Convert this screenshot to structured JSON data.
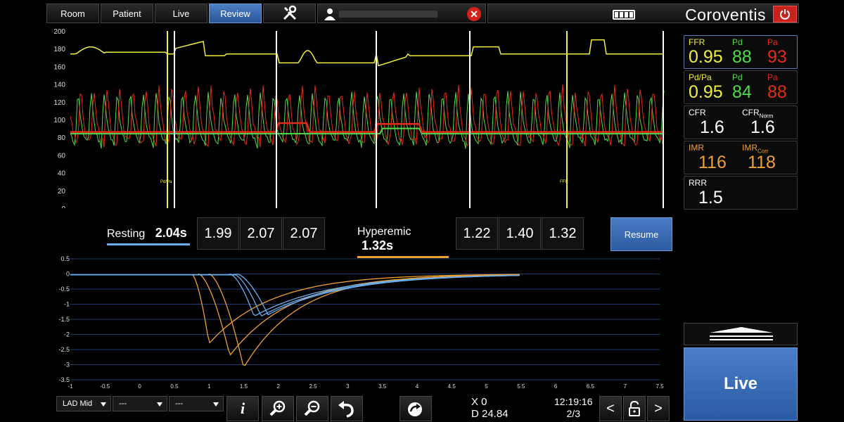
{
  "nav": {
    "tabs": [
      "Room",
      "Patient",
      "Live",
      "Review"
    ],
    "active_tab": "Review",
    "brand": "Coroventis"
  },
  "top_chart": {
    "y_ticks": [
      "200",
      "180",
      "160",
      "140",
      "120",
      "100",
      "80",
      "60",
      "40",
      "20",
      "0"
    ],
    "markers": [
      "Pd/Pa",
      "FFR"
    ]
  },
  "values": {
    "ffr": {
      "label": "FFR",
      "value": "0.95",
      "pd_label": "Pd",
      "pd": "88",
      "pa_label": "Pa",
      "pa": "93"
    },
    "pdpa": {
      "label": "Pd/Pa",
      "value": "0.95",
      "pd_label": "Pd",
      "pd": "84",
      "pa_label": "Pa",
      "pa": "88"
    },
    "cfr": {
      "label": "CFR",
      "value": "1.6",
      "norm_label": "CFR",
      "norm_sub": "Norm",
      "norm": "1.6"
    },
    "imr": {
      "label": "IMR",
      "value": "116",
      "corr_label": "IMR",
      "corr_sub": "Corr",
      "corr": "118"
    },
    "rrr": {
      "label": "RRR",
      "value": "1.5"
    }
  },
  "transit": {
    "resting_label": "Resting",
    "resting_value": "2.04s",
    "resting_times": [
      "1.99",
      "2.07",
      "2.07"
    ],
    "hyperemic_label": "Hyperemic",
    "hyperemic_value": "1.32s",
    "hyperemic_times": [
      "1.22",
      "1.40",
      "1.32"
    ],
    "resume": "Resume"
  },
  "bottom_chart": {
    "y_ticks": [
      "0.5",
      "0",
      "-0.5",
      "-1",
      "-1.5",
      "-2",
      "-2.5",
      "-3",
      "-3.5"
    ],
    "x_ticks": [
      "-1",
      "-0.5",
      "0",
      "0.5",
      "1",
      "1.5",
      "2",
      "2.5",
      "3",
      "3.5",
      "4",
      "4.5",
      "5",
      "5.5",
      "6",
      "6.5",
      "7",
      "7.5"
    ]
  },
  "toolbar": {
    "vessel": "LAD Mid",
    "sel2": "---",
    "sel3": "---",
    "x_readout": "X 0",
    "d_readout": "D 24.84",
    "time": "12:19:16",
    "page": "2/3",
    "live": "Live"
  },
  "colors": {
    "yellow": "#f2ee3c",
    "green": "#4fdc4a",
    "red": "#e52a1a",
    "blue": "#6aaef0",
    "orange": "#f0a030",
    "accent": "#2f5fa6"
  }
}
